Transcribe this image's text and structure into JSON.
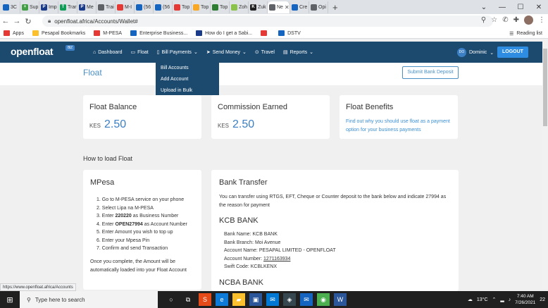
{
  "browser": {
    "tabs": [
      {
        "label": "3C",
        "color": "#1565c0",
        "glyph": ""
      },
      {
        "label": "Sup",
        "color": "#43a047",
        "glyph": "+"
      },
      {
        "label": "Imp",
        "color": "#1a3a8a",
        "glyph": "P"
      },
      {
        "label": "Trar",
        "color": "#0f9d58",
        "glyph": "T"
      },
      {
        "label": "Me",
        "color": "#1a3a8a",
        "glyph": "P"
      },
      {
        "label": "Trai",
        "color": "#5f6368",
        "glyph": ""
      },
      {
        "label": "M-I",
        "color": "#e53935",
        "glyph": ""
      },
      {
        "label": "(56",
        "color": "#1565c0",
        "glyph": ""
      },
      {
        "label": "(56",
        "color": "#1565c0",
        "glyph": ""
      },
      {
        "label": "Top",
        "color": "#e53935",
        "glyph": ""
      },
      {
        "label": "Top",
        "color": "#f9a825",
        "glyph": ""
      },
      {
        "label": "Top",
        "color": "#2e7d32",
        "glyph": ""
      },
      {
        "label": "Zoh",
        "color": "#8bc34a",
        "glyph": ""
      },
      {
        "label": "Zuk",
        "color": "#212121",
        "glyph": "K"
      },
      {
        "label": "Ne",
        "color": "#5f6368",
        "glyph": ""
      },
      {
        "label": "Cre",
        "color": "#1565c0",
        "glyph": ""
      },
      {
        "label": "Opi",
        "color": "#5f6368",
        "glyph": ""
      }
    ],
    "active_tab_label": "",
    "new_tab": "+",
    "window_controls": [
      "⌄",
      "—",
      "☐",
      "✕"
    ],
    "url": "openfloat.africa/Accounts/Wallet#",
    "bookmarks": [
      {
        "label": "Apps",
        "color": "#e53935"
      },
      {
        "label": "Pesapal Bookmarks",
        "color": "#fbc02d"
      },
      {
        "label": "M-PESA",
        "color": "#e53935"
      },
      {
        "label": "Enterprise Business...",
        "color": "#1565c0"
      },
      {
        "label": "How do I get a Sabi...",
        "color": "#1a3a8a"
      },
      {
        "label": "",
        "color": "#e53935"
      },
      {
        "label": "DSTV",
        "color": "#1565c0"
      }
    ],
    "reading_list": "Reading list"
  },
  "app": {
    "logo": "openfloat",
    "logo_badge": "BIZ",
    "menu": [
      {
        "label": "Dashboard",
        "icon": "⌂",
        "caret": ""
      },
      {
        "label": "Float",
        "icon": "▭",
        "caret": ""
      },
      {
        "label": "Bill Payments",
        "icon": "▯",
        "caret": "⌄"
      },
      {
        "label": "Send Money",
        "icon": "➤",
        "caret": "⌄"
      },
      {
        "label": "Travel",
        "icon": "⊙",
        "caret": ""
      },
      {
        "label": "Reports",
        "icon": "▤",
        "caret": "⌄"
      }
    ],
    "user_initials": "DO",
    "user_name": "Dominic",
    "user_caret": "⌄",
    "logout": "LOGOUT",
    "page_title": "Float",
    "submit_button": "Submit Bank Deposit",
    "dropdown": [
      "Bill Accounts",
      "Add Account",
      "Upload in Bulk"
    ],
    "cards": {
      "float_balance": {
        "title": "Float Balance",
        "currency": "KES",
        "value": "2.50"
      },
      "commission": {
        "title": "Commission Earned",
        "currency": "KES",
        "value": "2.50"
      },
      "benefits": {
        "title": "Float Benefits",
        "text": "Find out why you should use float as a payment option for your business payments"
      }
    },
    "how_to": "How to load Float",
    "mpesa": {
      "title": "MPesa",
      "steps": [
        {
          "pre": "1. Go to M-PESA service on your phone",
          "bold": "",
          "post": ""
        },
        {
          "pre": "2. Select Lipa na M-PESA",
          "bold": "",
          "post": ""
        },
        {
          "pre": "3. Enter ",
          "bold": "220220",
          "post": " as Business Number"
        },
        {
          "pre": "4. Enter ",
          "bold": "OPEN27994",
          "post": " as Account Number"
        },
        {
          "pre": "5. Enter Amount you wish to top up",
          "bold": "",
          "post": ""
        },
        {
          "pre": "6. Enter your Mpesa Pin",
          "bold": "",
          "post": ""
        },
        {
          "pre": "7. Confirm and send Transaction",
          "bold": "",
          "post": ""
        }
      ],
      "note": "Once you complete, the Amount will be automatically loaded into your Float Account"
    },
    "bank": {
      "title": "Bank Transfer",
      "intro": "You can transfer using RTGS, EFT, Cheque or Counter deposit to the bank below and indicate 27994 as the reason for payment",
      "kcb_title": "KCB BANK",
      "kcb_details": [
        {
          "label": "Bank Name: ",
          "value": "KCB BANK"
        },
        {
          "label": "Bank Branch: ",
          "value": "Moi Avenue"
        },
        {
          "label": "Account Name: ",
          "value": "PESAPAL LIMITED - OPENFLOAT"
        },
        {
          "label": "Account Number: ",
          "value": "1271163934"
        },
        {
          "label": "Swift Code: ",
          "value": "KCBLKENX"
        }
      ],
      "ncba_title": "NCBA BANK"
    }
  },
  "status_url": "https://www.openfloat.africa/Accounts",
  "taskbar": {
    "start": "⊞",
    "search_placeholder": "Type here to search",
    "apps": [
      {
        "name": "cortana-icon",
        "glyph": "○",
        "color": "#202020"
      },
      {
        "name": "task-view-icon",
        "glyph": "⧉",
        "color": "#202020"
      },
      {
        "name": "app-s-icon",
        "glyph": "S",
        "color": "#e64a19"
      },
      {
        "name": "edge-icon",
        "glyph": "e",
        "color": "#0f7bd8"
      },
      {
        "name": "file-explorer-icon",
        "glyph": "▰",
        "color": "#fbc02d"
      },
      {
        "name": "store-icon",
        "glyph": "▣",
        "color": "#2b579a"
      },
      {
        "name": "mail-icon",
        "glyph": "✉",
        "color": "#0078d4"
      },
      {
        "name": "app-dark-icon",
        "glyph": "◈",
        "color": "#37474f"
      },
      {
        "name": "mail2-icon",
        "glyph": "✉",
        "color": "#1565c0"
      },
      {
        "name": "chrome-icon",
        "glyph": "◉",
        "color": "#4caf50"
      },
      {
        "name": "word-icon",
        "glyph": "W",
        "color": "#2b579a"
      }
    ],
    "weather": "13°C",
    "time": "7:40 AM",
    "date": "7/26/2021",
    "notifications": "22"
  }
}
